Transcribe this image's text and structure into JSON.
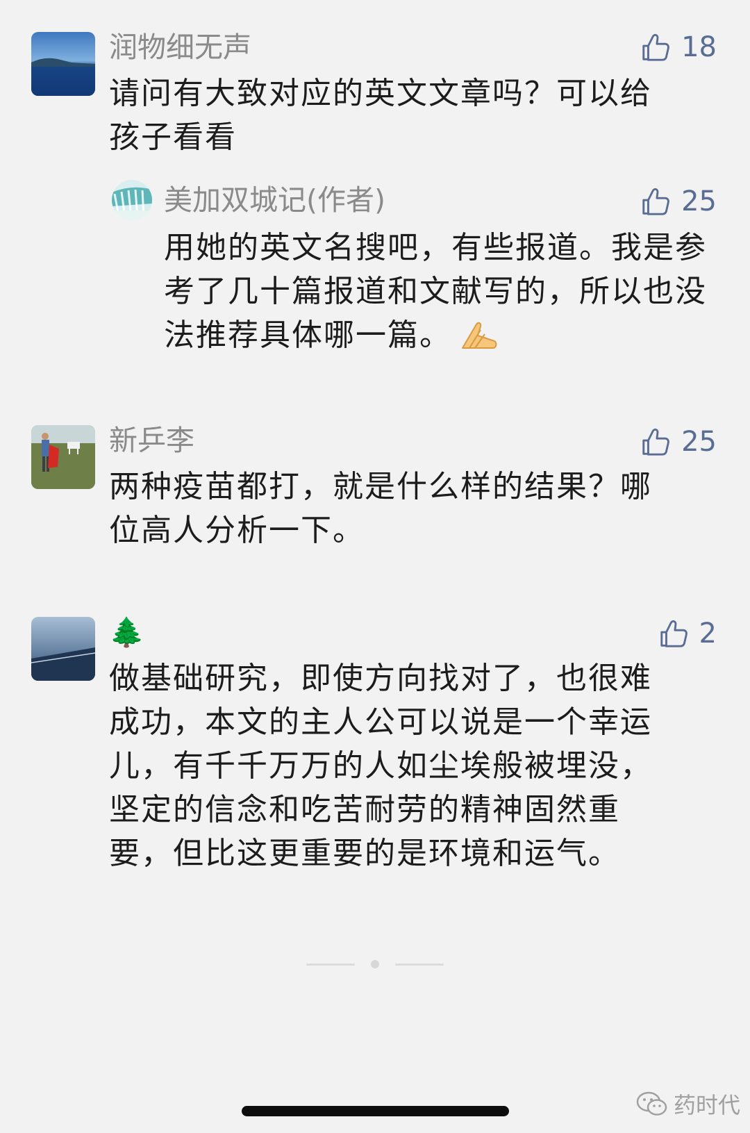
{
  "comments": [
    {
      "nickname": "润物细无声",
      "likes": "18",
      "avatar": "ocean-coast-avatar",
      "text": "请问有大致对应的英文文章吗？可以给孩子看看",
      "reply": {
        "nickname": "美加双城记(作者)",
        "likes": "25",
        "avatar": "waterfall-avatar",
        "text": "用她的英文名搜吧，有些报道。我是参考了几十篇报道和文献写的，所以也没法推荐具体哪一篇。",
        "emoji": "clasped-hands-emoji"
      }
    },
    {
      "nickname": "新乒李",
      "likes": "25",
      "avatar": "field-person-avatar",
      "text": "两种疫苗都打，就是什么样的结果？哪位高人分析一下。"
    },
    {
      "nickname": "🌲",
      "likes": "2",
      "avatar": "sea-horizon-avatar",
      "text": "做基础研究，即使方向找对了，也很难成功，本文的主人公可以说是一个幸运儿，有千千万万的人如尘埃般被埋没，坚定的信念和吃苦耐劳的精神固然重要，但比这更重要的是环境和运气。"
    }
  ],
  "watermark": {
    "text": "药时代",
    "icon": "wechat-icon"
  },
  "colors": {
    "background": "#f2f2f2",
    "nickname": "#8a8a8a",
    "like": "#586c94",
    "text": "#1c1c1c"
  }
}
